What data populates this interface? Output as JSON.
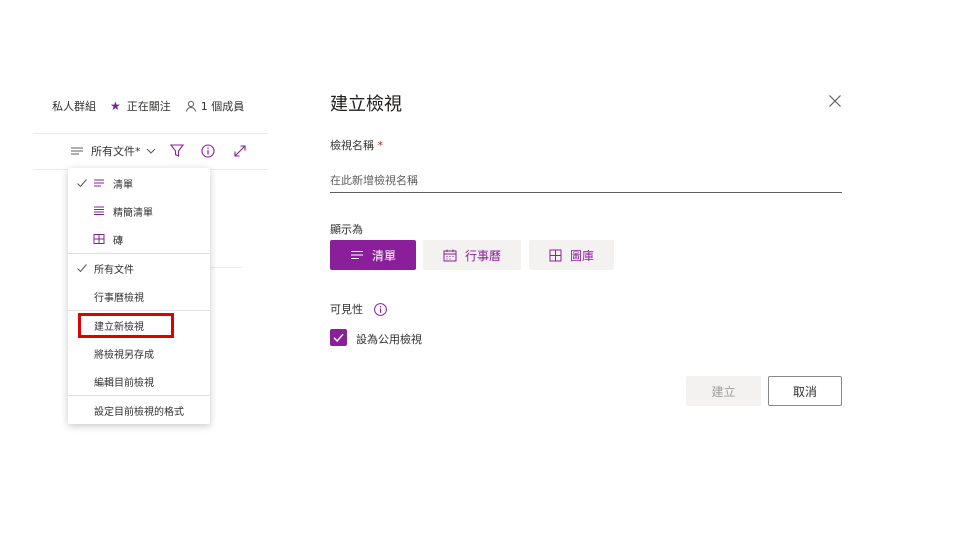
{
  "group_bar": {
    "group_type": "私人群組",
    "following": "正在關注",
    "members": "1 個成員"
  },
  "command_bar": {
    "view_selector": "所有文件*"
  },
  "view_menu": {
    "items": [
      {
        "label": "清單",
        "checked": true,
        "icon": "list-icon"
      },
      {
        "label": "精簡清單",
        "checked": false,
        "icon": "compact-list-icon"
      },
      {
        "label": "磚",
        "checked": false,
        "icon": "tiles-icon"
      },
      {
        "label": "所有文件",
        "checked": true
      },
      {
        "label": "行事曆檢視",
        "checked": false
      },
      {
        "label": "建立新檢視",
        "highlighted": true
      },
      {
        "label": "將檢視另存成"
      },
      {
        "label": "編輯目前檢視"
      },
      {
        "label": "設定目前檢視的格式"
      }
    ]
  },
  "panel": {
    "title": "建立檢視",
    "name_label": "檢視名稱",
    "required_mark": "*",
    "name_placeholder": "在此新增檢視名稱",
    "show_as_label": "顯示為",
    "show_as_options": [
      {
        "label": "清單",
        "selected": true,
        "icon": "list-icon"
      },
      {
        "label": "行事曆",
        "selected": false,
        "icon": "calendar-icon"
      },
      {
        "label": "圖庫",
        "selected": false,
        "icon": "gallery-icon"
      }
    ],
    "visibility_label": "可見性",
    "public_view_label": "設為公用檢視",
    "public_view_checked": true,
    "create_button": "建立",
    "cancel_button": "取消"
  },
  "colors": {
    "accent": "#8b1f9b",
    "highlight_border": "#e00000"
  }
}
